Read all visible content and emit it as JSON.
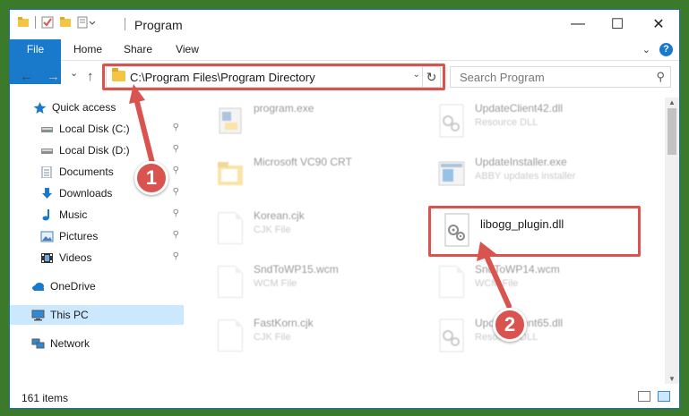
{
  "window": {
    "title": "Program",
    "minimize_glyph": "—",
    "maximize_glyph": "☐",
    "close_glyph": "✕"
  },
  "ribbon": {
    "tabs": [
      {
        "label": "File"
      },
      {
        "label": "Home"
      },
      {
        "label": "Share"
      },
      {
        "label": "View"
      }
    ],
    "collapse_glyph": "⌄",
    "help_glyph": "?"
  },
  "navbar": {
    "back_glyph": "←",
    "forward_glyph": "→",
    "recent_glyph": "⌄",
    "up_glyph": "↑",
    "address_path": "C:\\Program Files\\Program Directory",
    "address_dropdown_glyph": "⌄",
    "refresh_glyph": "↻",
    "search_placeholder": "Search Program",
    "search_icon_glyph": "⚲"
  },
  "sidebar": {
    "items": [
      {
        "label": "Quick access",
        "icon": "star-icon",
        "pinned": false
      },
      {
        "label": "Local Disk (C:)",
        "icon": "drive-icon",
        "pinned": true
      },
      {
        "label": "Local Disk (D:)",
        "icon": "drive-icon",
        "pinned": true
      },
      {
        "label": "Documents",
        "icon": "documents-icon",
        "pinned": true
      },
      {
        "label": "Downloads",
        "icon": "download-icon",
        "pinned": true
      },
      {
        "label": "Music",
        "icon": "music-icon",
        "pinned": true
      },
      {
        "label": "Pictures",
        "icon": "pictures-icon",
        "pinned": true
      },
      {
        "label": "Videos",
        "icon": "videos-icon",
        "pinned": true
      },
      {
        "label": "OneDrive",
        "icon": "cloud-icon",
        "pinned": false
      },
      {
        "label": "This PC",
        "icon": "computer-icon",
        "pinned": false,
        "selected": true
      },
      {
        "label": "Network",
        "icon": "network-icon",
        "pinned": false
      }
    ],
    "pin_glyph": "📌"
  },
  "files": [
    {
      "name": "program.exe",
      "type": "",
      "icon": "exe-icon"
    },
    {
      "name": "UpdateClient42.dll",
      "type": "Resource DLL",
      "icon": "dll-icon"
    },
    {
      "name": "Microsoft VC90 CRT",
      "type": "",
      "icon": "folder-icon"
    },
    {
      "name": "UpdateInstaller.exe",
      "type": "ABBY updates installer",
      "icon": "installer-icon"
    },
    {
      "name": "Korean.cjk",
      "type": "CJK File",
      "icon": "file-icon"
    },
    {
      "name": "libogg_plugin.dll",
      "type": "",
      "icon": "dll-icon"
    },
    {
      "name": "SndToWP15.wcm",
      "type": "WCM File",
      "icon": "file-icon"
    },
    {
      "name": "SndToWP14.wcm",
      "type": "WCM File",
      "icon": "file-icon"
    },
    {
      "name": "FastKorn.cjk",
      "type": "CJK File",
      "icon": "file-icon"
    },
    {
      "name": "UpdateClient65.dll",
      "type": "Resource DLL",
      "icon": "dll-icon"
    }
  ],
  "statusbar": {
    "item_count": "161 items"
  },
  "callouts": [
    {
      "label": "1"
    },
    {
      "label": "2"
    }
  ],
  "colors": {
    "accent": "#1979ca",
    "highlight": "#d9534f",
    "selected": "#cce8ff"
  }
}
